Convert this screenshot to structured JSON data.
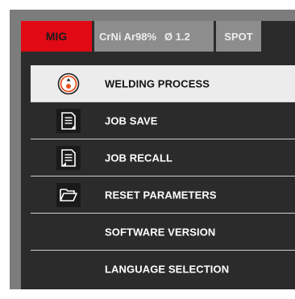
{
  "status_bar": {
    "mode": "MIG",
    "material_gas": "CrNi Ar98%",
    "wire_diameter": "Ø 1.2",
    "spot": "SPOT"
  },
  "menu": {
    "items": [
      {
        "label": "WELDING PROCESS",
        "icon": "gauge-dial-icon",
        "selected": true
      },
      {
        "label": "JOB SAVE",
        "icon": "document-save-icon",
        "selected": false
      },
      {
        "label": "JOB RECALL",
        "icon": "document-recall-icon",
        "selected": false
      },
      {
        "label": "RESET PARAMETERS",
        "icon": "folder-open-icon",
        "selected": false
      },
      {
        "label": "SOFTWARE VERSION",
        "icon": "",
        "selected": false
      },
      {
        "label": "LANGUAGE SELECTION",
        "icon": "",
        "selected": false
      }
    ]
  },
  "colors": {
    "mode_accent": "#e10a14",
    "panel_background": "#2b2b2b",
    "frame": "#7c7c7c",
    "selected_row": "#ececec",
    "icon_accent": "#e8501e"
  }
}
